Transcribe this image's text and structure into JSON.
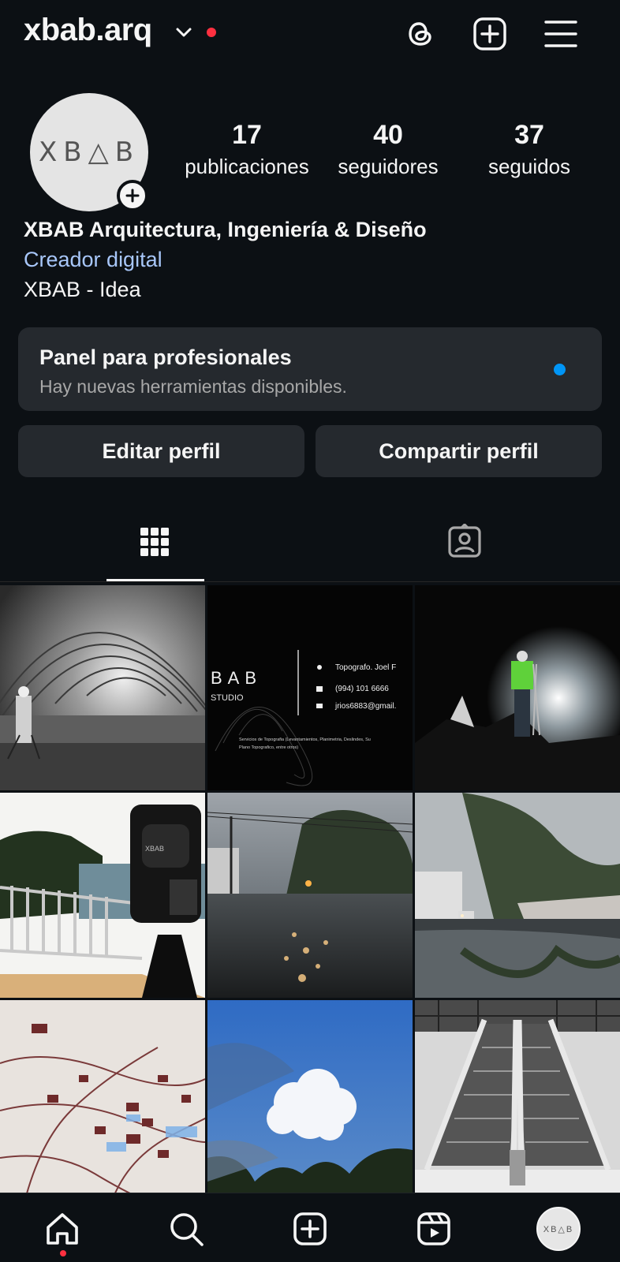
{
  "header": {
    "username": "xbab.arq",
    "icons": [
      "chevron-down-icon",
      "threads-icon",
      "create-icon",
      "menu-icon"
    ],
    "notification_color": "#ff3040"
  },
  "profile": {
    "avatar_text": "XB△B",
    "stats": [
      {
        "value": "17",
        "label": "publicaciones"
      },
      {
        "value": "40",
        "label": "seguidores"
      },
      {
        "value": "37",
        "label": "seguidos"
      }
    ],
    "full_name": "XBAB Arquitectura, Ingeniería & Diseño",
    "category": "Creador digital",
    "bio": "XBAB - Idea"
  },
  "panel": {
    "title": "Panel para profesionales",
    "subtitle": "Hay nuevas herramientas disponibles.",
    "dot_color": "#0095f6"
  },
  "actions": {
    "edit": "Editar perfil",
    "share": "Compartir perfil"
  },
  "tabs": [
    {
      "name": "grid",
      "icon": "grid-icon",
      "active": true
    },
    {
      "name": "tagged",
      "icon": "tagged-icon",
      "active": false
    }
  ],
  "posts": [
    {
      "subject": "tunnel-survey-bw"
    },
    {
      "subject": "business-card",
      "card": {
        "logo": "BAB",
        "studio": "STUDIO",
        "role": "Topografo. Joel F",
        "phone": "(994) 101 6666",
        "email": "jrios6883@gmail.",
        "services": "Servicios de Topografia (Levantamientos, Planimetria, Deslindes, Su",
        "services2": "Plano Topografico, entre otros)"
      }
    },
    {
      "subject": "cave-survey-night"
    },
    {
      "subject": "total-station-balcony",
      "brand": "XBAB"
    },
    {
      "subject": "wet-street-dusk"
    },
    {
      "subject": "street-reflection"
    },
    {
      "subject": "urban-model"
    },
    {
      "subject": "sky-cloud"
    },
    {
      "subject": "escalators-bw"
    }
  ],
  "bottom_nav": {
    "items": [
      "home-icon",
      "search-icon",
      "create-icon",
      "reels-icon",
      "profile-avatar"
    ],
    "avatar_text": "XB△B"
  }
}
